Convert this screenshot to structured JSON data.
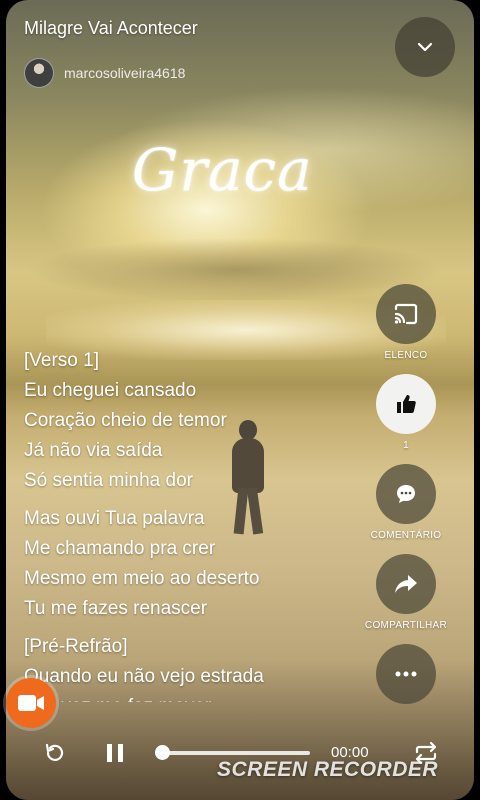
{
  "header": {
    "title": "Milagre Vai Acontecer",
    "author": "marcosoliveira4618"
  },
  "artwork": {
    "overlay_text": "Graca"
  },
  "lyrics": {
    "stanzas": [
      [
        "[Verso 1]",
        "Eu cheguei cansado",
        "Coração cheio de temor",
        "Já não via saída",
        "Só sentia minha dor"
      ],
      [
        "Mas ouvi Tua palavra",
        "Me chamando pra crer",
        "Mesmo em meio ao deserto",
        "Tu me fazes renascer"
      ],
      [
        "[Pré-Refrão]",
        "Quando eu não vejo estrada",
        "Tua voz me faz mover"
      ]
    ]
  },
  "actions": {
    "cast_label": "ELENCO",
    "like_count": "1",
    "comment_label": "COMENTÁRIO",
    "share_label": "COMPARTILHAR"
  },
  "player": {
    "time": "00:00",
    "progress": 0.0
  },
  "watermark": "SCREEN RECORDER",
  "colors": {
    "recorder_accent": "#f06a1e"
  },
  "icons": [
    "chevron-down-icon",
    "cast-icon",
    "thumbs-up-icon",
    "comment-icon",
    "share-icon",
    "more-icon",
    "video-camera-icon",
    "replay-icon",
    "pause-icon",
    "repeat-icon"
  ]
}
